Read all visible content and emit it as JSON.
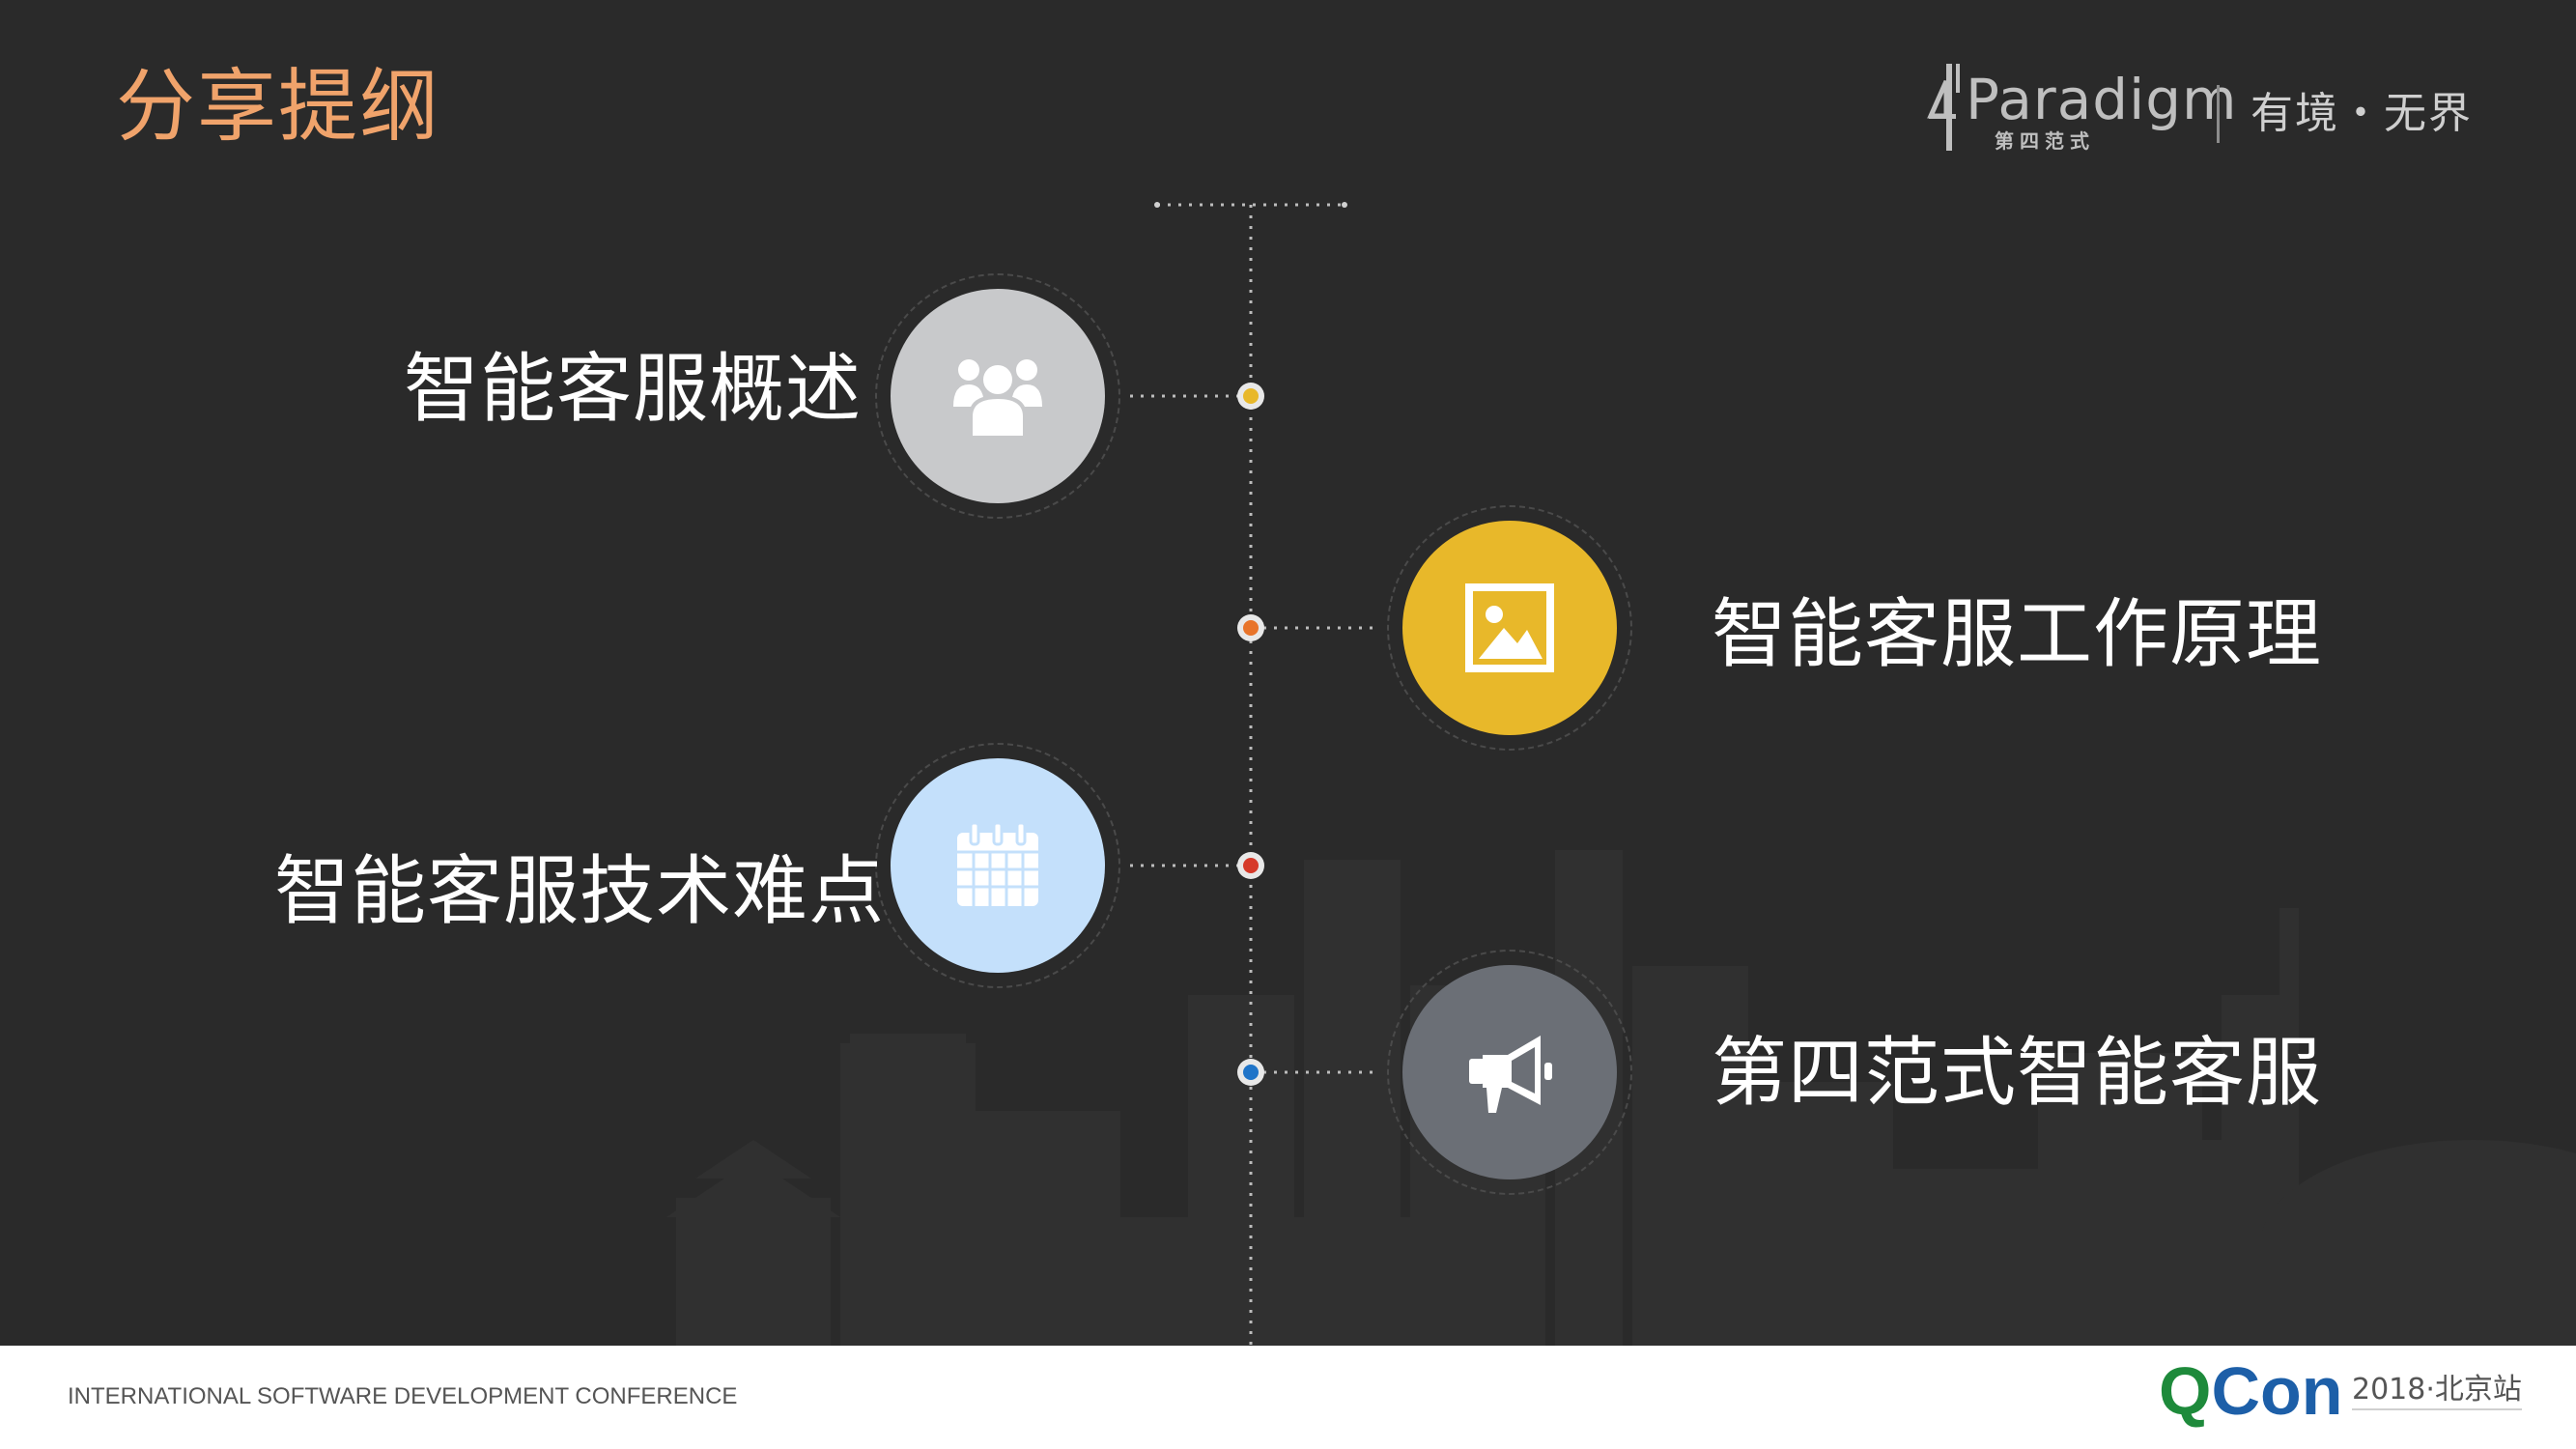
{
  "slide": {
    "title": "分享提纲",
    "colors": {
      "background": "#2a2a2a",
      "title": "#f0a36b"
    }
  },
  "logo": {
    "mark_text": "4",
    "brand": "Paradigm",
    "subtitle": "第四范式",
    "slogan": "有境・无界"
  },
  "timeline": {
    "items": [
      {
        "label": "智能客服概述",
        "icon": "people-icon",
        "color": "#c8c9cb",
        "dot_color": "#e8b82a",
        "side": "left"
      },
      {
        "label": "智能客服工作原理",
        "icon": "image-icon",
        "color": "#e8b82a",
        "dot_color": "#e8742a",
        "side": "right"
      },
      {
        "label": "智能客服技术难点",
        "icon": "calendar-icon",
        "color": "#c4e0fb",
        "dot_color": "#d63a2a",
        "side": "left"
      },
      {
        "label": "第四范式智能客服",
        "icon": "megaphone-icon",
        "color": "#6b6f76",
        "dot_color": "#1f74c8",
        "side": "right"
      }
    ]
  },
  "footer": {
    "conference": "INTERNATIONAL SOFTWARE DEVELOPMENT CONFERENCE",
    "brand_q": "Q",
    "brand_con": "Con",
    "edition": "2018·北京站"
  }
}
